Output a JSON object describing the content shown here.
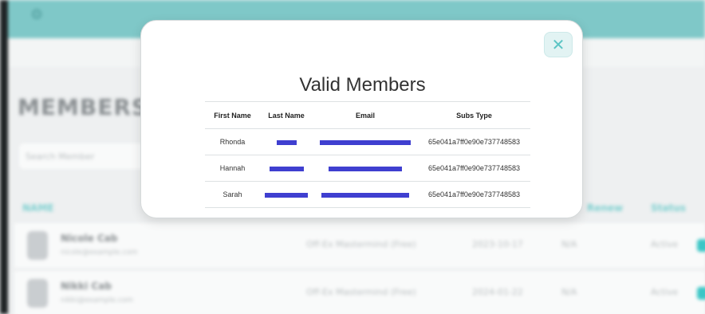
{
  "background": {
    "logo_icon": "gear-icon",
    "page_title": "MEMBERS",
    "search_placeholder": "Search Member",
    "columns": {
      "name": "NAME",
      "renew": "Renew",
      "status": "Status"
    },
    "rows": [
      {
        "name": "Nicole Cab",
        "email": "nicole@example.com",
        "plan": "Off-Ex Mastermind (Free)",
        "date": "2023-10-17",
        "renew": "N/A",
        "status": "Active"
      },
      {
        "name": "Nikki Cab",
        "email": "nikki@example.com",
        "plan": "Off-Ex Mastermind (Free)",
        "date": "2024-01-22",
        "renew": "N/A",
        "status": "Active"
      }
    ]
  },
  "modal": {
    "title": "Valid Members",
    "close_icon": "close-icon",
    "close_symbol": "✕",
    "headers": [
      "First Name",
      "Last Name",
      "Email",
      "Subs Type"
    ],
    "rows": [
      {
        "first_name": "Rhonda",
        "subs_type": "65e041a7ff0e90e737748583"
      },
      {
        "first_name": "Hannah",
        "subs_type": "65e041a7ff0e90e737748583"
      },
      {
        "first_name": "Sarah",
        "subs_type": "65e041a7ff0e90e737748583"
      }
    ],
    "redaction_color": "#3f3fd0"
  }
}
